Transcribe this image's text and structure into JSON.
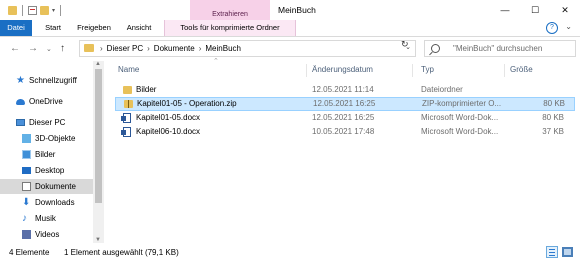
{
  "window": {
    "title": "MeinBuch",
    "context_group": "Extrahieren",
    "controls": {
      "minimize": "—",
      "maximize": "☐",
      "close": "✕"
    }
  },
  "ribbon": {
    "tabs": [
      "Datei",
      "Start",
      "Freigeben",
      "Ansicht",
      "Tools für komprimierte Ordner"
    ]
  },
  "address": {
    "breadcrumbs": [
      "Dieser PC",
      "Dokumente",
      "MeinBuch"
    ]
  },
  "search": {
    "placeholder": "\"MeinBuch\" durchsuchen"
  },
  "nav": {
    "items": [
      {
        "label": "Schnellzugriff",
        "icon": "star-icon"
      },
      {
        "label": "OneDrive",
        "icon": "cloud-icon"
      },
      {
        "label": "Dieser PC",
        "icon": "computer-icon"
      },
      {
        "label": "3D-Objekte",
        "icon": "cube-icon"
      },
      {
        "label": "Bilder",
        "icon": "pictures-icon"
      },
      {
        "label": "Desktop",
        "icon": "desktop-icon"
      },
      {
        "label": "Dokumente",
        "icon": "documents-icon",
        "selected": true
      },
      {
        "label": "Downloads",
        "icon": "download-icon"
      },
      {
        "label": "Musik",
        "icon": "music-icon"
      },
      {
        "label": "Videos",
        "icon": "video-icon"
      }
    ]
  },
  "columns": {
    "name": "Name",
    "date": "Änderungsdatum",
    "type": "Typ",
    "size": "Größe"
  },
  "files": [
    {
      "name": "Bilder",
      "date": "12.05.2021 11:14",
      "type": "Dateiordner",
      "size": "",
      "icon": "folder-icon"
    },
    {
      "name": "Kapitel01-05 - Operation.zip",
      "date": "12.05.2021 16:25",
      "type": "ZIP-komprimierter O...",
      "size": "80 KB",
      "icon": "zip-folder-icon",
      "selected": true
    },
    {
      "name": "Kapitel01-05.docx",
      "date": "12.05.2021 16:25",
      "type": "Microsoft Word-Dok...",
      "size": "80 KB",
      "icon": "word-doc-icon"
    },
    {
      "name": "Kapitel06-10.docx",
      "date": "10.05.2021 17:48",
      "type": "Microsoft Word-Dok...",
      "size": "37 KB",
      "icon": "word-doc-icon"
    }
  ],
  "status": {
    "count": "4 Elemente",
    "selection": "1 Element ausgewählt (79,1 KB)"
  },
  "colors": {
    "accent": "#1a6fc4",
    "context_tab": "#f7d1e8",
    "selection": "#cce8ff",
    "nav_selected": "#d9d9d9",
    "folder": "#e8c15a"
  }
}
